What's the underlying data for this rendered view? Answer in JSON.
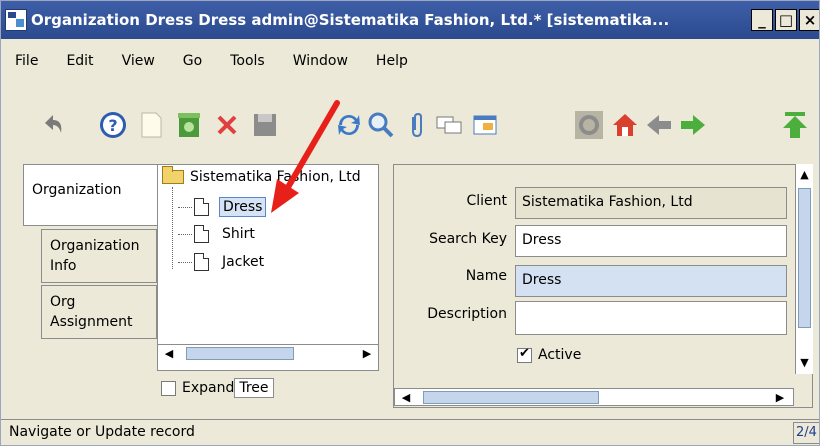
{
  "window": {
    "title": "Organization  Dress  Dress  admin@Sistematika Fashion, Ltd.* [sistematika...",
    "minimize": "_",
    "maximize": "□",
    "close": "×"
  },
  "menu": [
    "File",
    "Edit",
    "View",
    "Go",
    "Tools",
    "Window",
    "Help"
  ],
  "toolbar": {
    "icons": [
      "undo-icon",
      "help-icon",
      "new-record-icon",
      "copy-record-icon",
      "delete-icon",
      "save-icon",
      "refresh-icon",
      "find-icon",
      "attachment-icon",
      "chat-icon",
      "grid-toggle-icon",
      "history-icon",
      "home-icon",
      "previous-icon",
      "next-icon",
      "first-record-icon"
    ]
  },
  "tabs": [
    "Organization",
    "Organization Info",
    "Org Assignment"
  ],
  "tree": {
    "root": "Sistematika Fashion, Ltd",
    "items": [
      "Dress",
      "Shirt",
      "Jacket"
    ],
    "selected": "Dress",
    "expand_label": "Expand",
    "tree_label": "Tree",
    "expand_checked": false
  },
  "form": {
    "client_label": "Client",
    "client_value": "Sistematika Fashion, Ltd",
    "search_key_label": "Search Key",
    "search_key_value": "Dress",
    "name_label": "Name",
    "name_value": "Dress",
    "description_label": "Description",
    "description_value": "",
    "active_label": "Active",
    "active_checked": true
  },
  "status": {
    "message": "Navigate or Update record",
    "record_count": "2/4"
  },
  "colors": {
    "titlebar": "#2b4a8e",
    "annotation_arrow": "#e8201a",
    "selection": "#d5e3f5"
  }
}
